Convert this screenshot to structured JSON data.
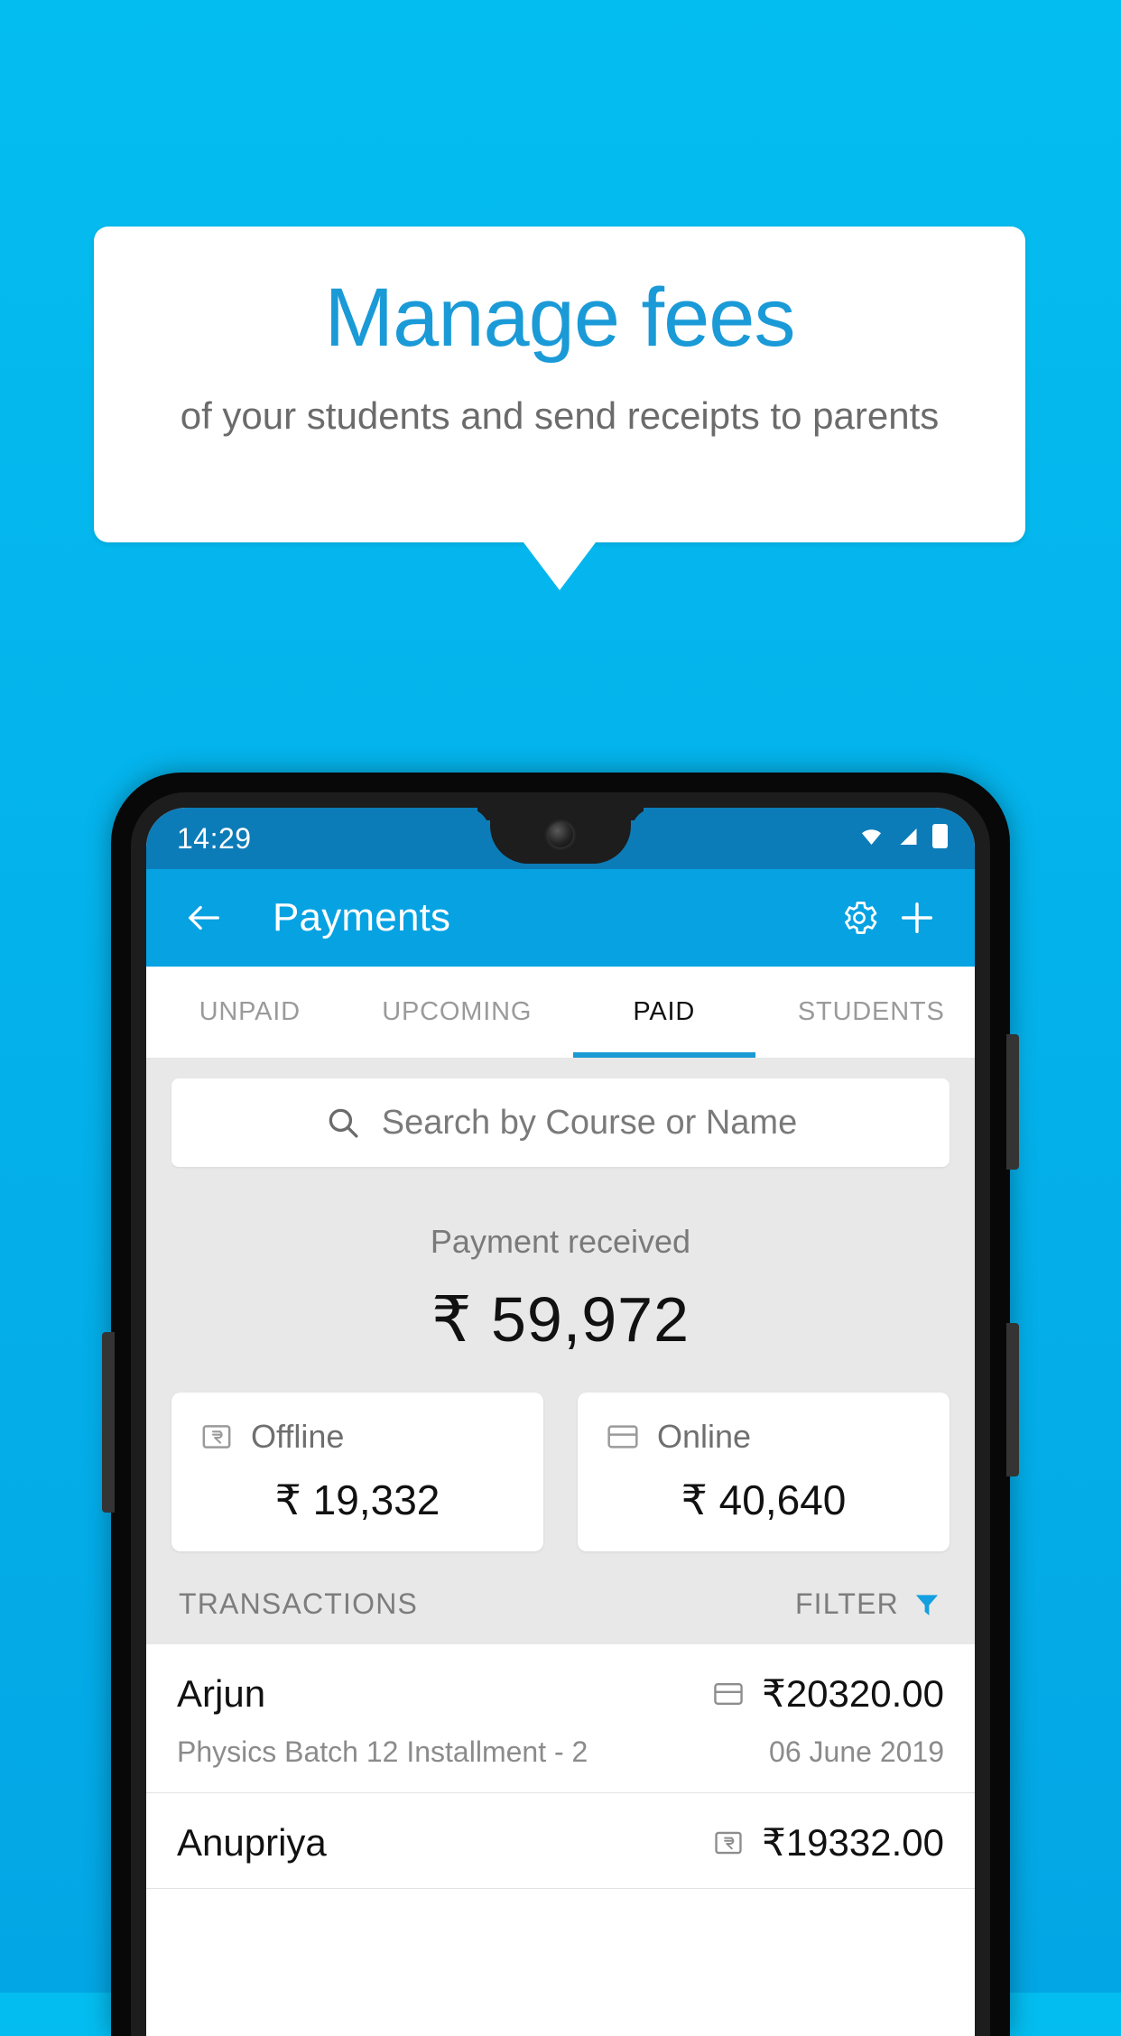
{
  "promo": {
    "title": "Manage fees",
    "subtitle": "of your students and send receipts to parents",
    "title_color": "#1a9ad7",
    "background_color": "#04b4ec"
  },
  "phone": {
    "status_bar": {
      "time": "14:29",
      "icons": [
        "wifi-icon",
        "signal-icon",
        "battery-icon"
      ],
      "background_color": "#0c7cb8"
    },
    "app_bar": {
      "back_label": "←",
      "title": "Payments",
      "settings_icon": "gear-icon",
      "add_icon": "plus-icon",
      "background_color": "#06a2e2"
    },
    "tabs": [
      {
        "label": "UNPAID",
        "active": false
      },
      {
        "label": "UPCOMING",
        "active": false
      },
      {
        "label": "PAID",
        "active": true
      },
      {
        "label": "STUDENTS",
        "active": false
      }
    ],
    "active_tab_indicator_color": "#1b9ad3",
    "search": {
      "placeholder": "Search by Course or Name",
      "value": "",
      "icon": "search-icon"
    },
    "summary": {
      "label": "Payment received",
      "amount": "₹ 59,972"
    },
    "payment_modes": [
      {
        "label": "Offline",
        "amount": "₹ 19,332",
        "icon": "rupee-note-icon"
      },
      {
        "label": "Online",
        "amount": "₹ 40,640",
        "icon": "credit-card-icon"
      }
    ],
    "list_header": {
      "title": "TRANSACTIONS",
      "filter_label": "FILTER",
      "filter_icon": "funnel-icon",
      "filter_icon_color": "#14a0e0"
    },
    "transactions": [
      {
        "name": "Arjun",
        "amount": "₹20320.00",
        "mode_icon": "credit-card-icon",
        "course": "Physics Batch 12 Installment - 2",
        "date": "06 June 2019"
      },
      {
        "name": "Anupriya",
        "amount": "₹19332.00",
        "mode_icon": "rupee-note-icon",
        "course": "",
        "date": ""
      }
    ]
  }
}
